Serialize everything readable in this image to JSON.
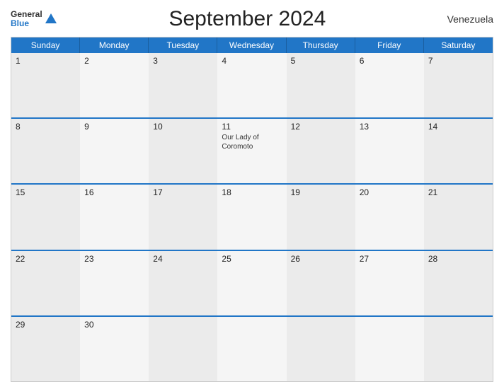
{
  "header": {
    "logo_general": "General",
    "logo_blue": "Blue",
    "title": "September 2024",
    "country": "Venezuela"
  },
  "day_headers": [
    "Sunday",
    "Monday",
    "Tuesday",
    "Wednesday",
    "Thursday",
    "Friday",
    "Saturday"
  ],
  "weeks": [
    [
      {
        "day": "1",
        "event": ""
      },
      {
        "day": "2",
        "event": ""
      },
      {
        "day": "3",
        "event": ""
      },
      {
        "day": "4",
        "event": ""
      },
      {
        "day": "5",
        "event": ""
      },
      {
        "day": "6",
        "event": ""
      },
      {
        "day": "7",
        "event": ""
      }
    ],
    [
      {
        "day": "8",
        "event": ""
      },
      {
        "day": "9",
        "event": ""
      },
      {
        "day": "10",
        "event": ""
      },
      {
        "day": "11",
        "event": "Our Lady of Coromoto"
      },
      {
        "day": "12",
        "event": ""
      },
      {
        "day": "13",
        "event": ""
      },
      {
        "day": "14",
        "event": ""
      }
    ],
    [
      {
        "day": "15",
        "event": ""
      },
      {
        "day": "16",
        "event": ""
      },
      {
        "day": "17",
        "event": ""
      },
      {
        "day": "18",
        "event": ""
      },
      {
        "day": "19",
        "event": ""
      },
      {
        "day": "20",
        "event": ""
      },
      {
        "day": "21",
        "event": ""
      }
    ],
    [
      {
        "day": "22",
        "event": ""
      },
      {
        "day": "23",
        "event": ""
      },
      {
        "day": "24",
        "event": ""
      },
      {
        "day": "25",
        "event": ""
      },
      {
        "day": "26",
        "event": ""
      },
      {
        "day": "27",
        "event": ""
      },
      {
        "day": "28",
        "event": ""
      }
    ],
    [
      {
        "day": "29",
        "event": ""
      },
      {
        "day": "30",
        "event": ""
      },
      {
        "day": "",
        "event": ""
      },
      {
        "day": "",
        "event": ""
      },
      {
        "day": "",
        "event": ""
      },
      {
        "day": "",
        "event": ""
      },
      {
        "day": "",
        "event": ""
      }
    ]
  ]
}
